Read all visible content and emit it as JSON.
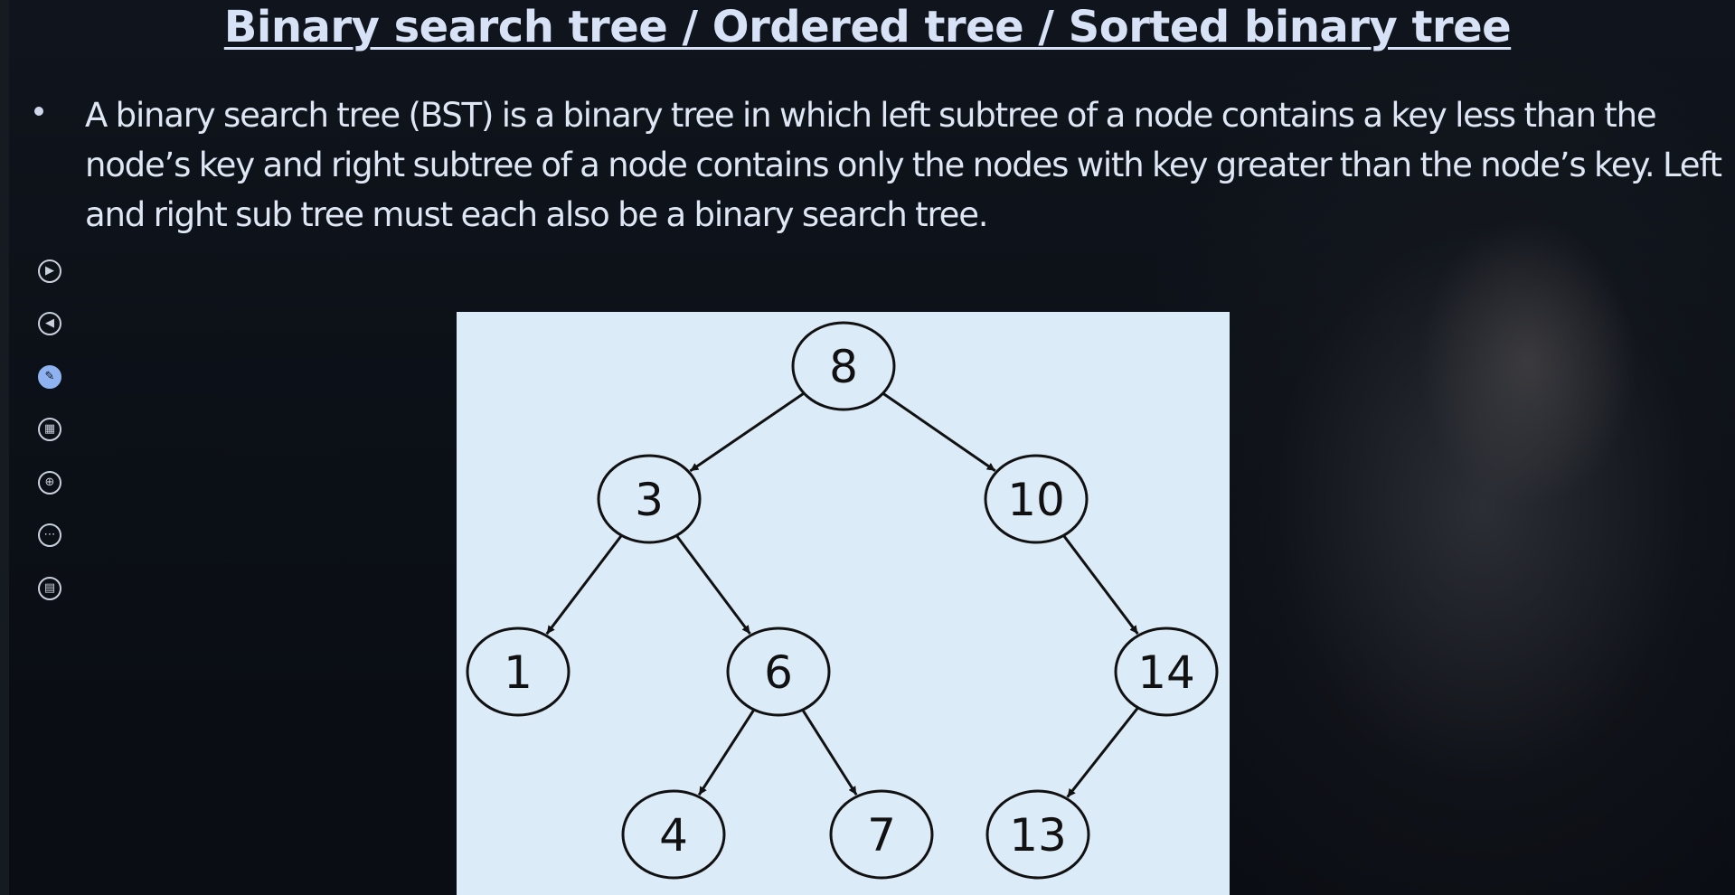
{
  "slide": {
    "title": "Binary search tree / Ordered tree / Sorted binary tree",
    "bullet": "A binary search tree (BST) is a binary tree in which left subtree of a node contains a key less than the node’s key and right subtree of a node contains only the nodes with key greater than the node’s key. Left and right sub tree must each also be a binary search tree."
  },
  "toolbar": {
    "items": [
      {
        "icon": "next-icon",
        "glyph": "▶"
      },
      {
        "icon": "previous-icon",
        "glyph": "◀"
      },
      {
        "icon": "pen-icon",
        "glyph": "✎"
      },
      {
        "icon": "slides-overview-icon",
        "glyph": "▦"
      },
      {
        "icon": "zoom-icon",
        "glyph": "⊕"
      },
      {
        "icon": "more-options-icon",
        "glyph": "⋯"
      },
      {
        "icon": "subtitles-icon",
        "glyph": "▤"
      }
    ]
  },
  "tree": {
    "nodes": [
      {
        "id": "n8",
        "label": "8"
      },
      {
        "id": "n3",
        "label": "3"
      },
      {
        "id": "n10",
        "label": "10"
      },
      {
        "id": "n1",
        "label": "1"
      },
      {
        "id": "n6",
        "label": "6"
      },
      {
        "id": "n14",
        "label": "14"
      },
      {
        "id": "n4",
        "label": "4"
      },
      {
        "id": "n7",
        "label": "7"
      },
      {
        "id": "n13",
        "label": "13"
      }
    ],
    "edges": [
      [
        "n8",
        "n3"
      ],
      [
        "n8",
        "n10"
      ],
      [
        "n3",
        "n1"
      ],
      [
        "n3",
        "n6"
      ],
      [
        "n10",
        "n14"
      ],
      [
        "n6",
        "n4"
      ],
      [
        "n6",
        "n7"
      ],
      [
        "n14",
        "n13"
      ]
    ]
  },
  "colors": {
    "background": "#0c1017",
    "text": "#dfe6f4",
    "diagram_background": "#dcebf8",
    "node_stroke": "#111111"
  }
}
